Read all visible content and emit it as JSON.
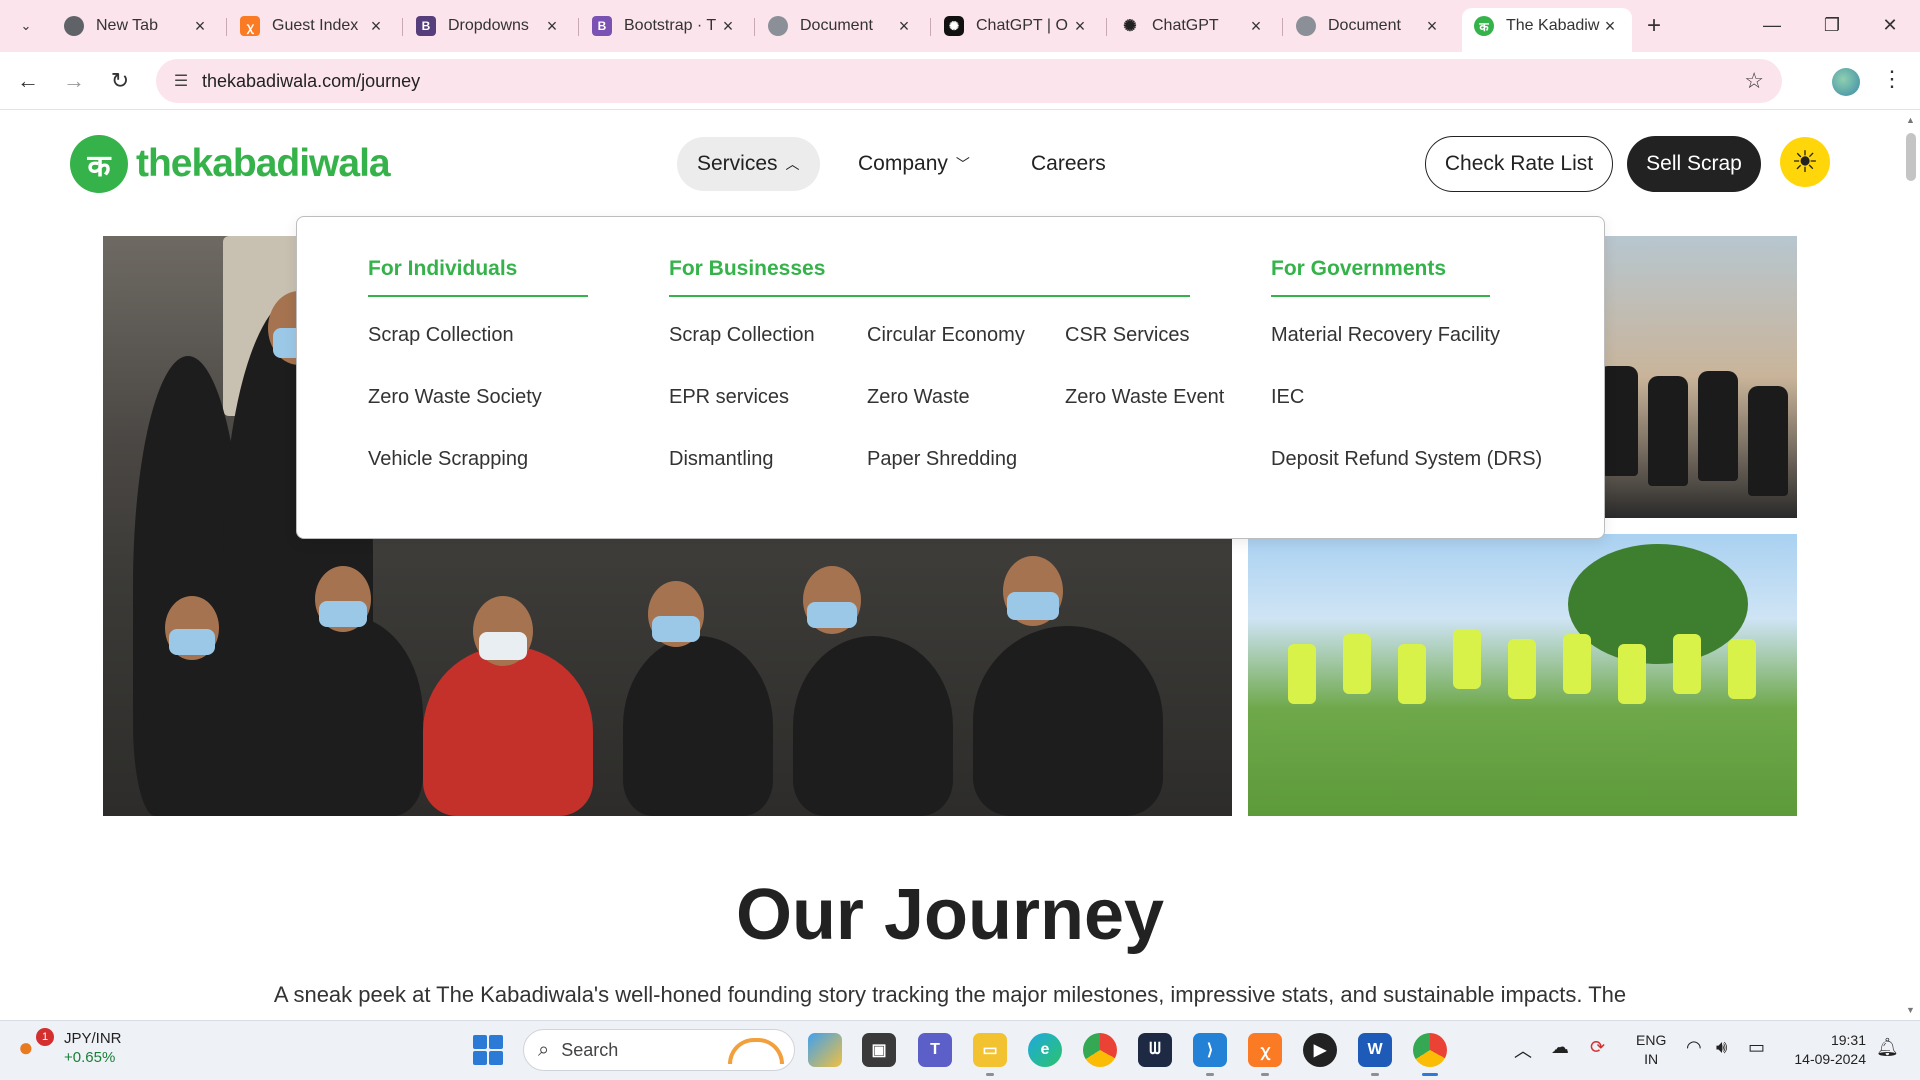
{
  "browser": {
    "tabs": [
      {
        "title": "New Tab",
        "favicon": "chrome-icon",
        "color": "#5f6368"
      },
      {
        "title": "Guest Index",
        "favicon": "xampp-icon",
        "color": "#fb7a24"
      },
      {
        "title": "Dropdowns",
        "favicon": "bootstrap-icon",
        "color": "#563d7c"
      },
      {
        "title": "Bootstrap · T",
        "favicon": "bootstrap-icon",
        "color": "#7952b3"
      },
      {
        "title": "Document",
        "favicon": "globe-icon",
        "color": "#5f6368"
      },
      {
        "title": "ChatGPT | O",
        "favicon": "chatgpt-icon",
        "color": "#111111"
      },
      {
        "title": "ChatGPT",
        "favicon": "chatgpt-icon",
        "color": "#ffffff"
      },
      {
        "title": "Document",
        "favicon": "globe-icon",
        "color": "#5f6368"
      },
      {
        "title": "The Kabadiw",
        "favicon": "kabadiwala-icon",
        "color": "#35b34a"
      }
    ],
    "url": "thekabadiwala.com/journey"
  },
  "site": {
    "logo_text": "thekabadiwala",
    "logo_glyph": "क",
    "nav": {
      "services": "Services",
      "company": "Company",
      "careers": "Careers"
    },
    "check_rate_list": "Check Rate List",
    "sell_scrap": "Sell Scrap",
    "brand_green": "#35b34a",
    "theme_toggle_color": "#ffd60a"
  },
  "services_menu": {
    "individuals": {
      "title": "For Individuals",
      "items": [
        "Scrap Collection",
        "Zero Waste Society",
        "Vehicle Scrapping"
      ]
    },
    "businesses": {
      "title": "For Businesses",
      "col1": [
        "Scrap Collection",
        "EPR services",
        "Dismantling"
      ],
      "col2": [
        "Circular Economy",
        "Zero Waste",
        "Paper Shredding"
      ],
      "col3": [
        "CSR Services",
        "Zero Waste Event"
      ]
    },
    "governments": {
      "title": "For Governments",
      "items": [
        "Material Recovery Facility",
        "IEC",
        "Deposit Refund System (DRS)"
      ]
    }
  },
  "journey": {
    "title": "Our Journey",
    "text": "A sneak peek at The Kabadiwala's well-honed founding story tracking the major milestones, impressive stats, and sustainable impacts. The"
  },
  "taskbar": {
    "widget_badge": "1",
    "widget_title": "JPY/INR",
    "widget_change": "+0.65%",
    "search_placeholder": "Search",
    "lang_line1": "ENG",
    "lang_line2": "IN",
    "time": "19:31",
    "date": "14-09-2024"
  }
}
